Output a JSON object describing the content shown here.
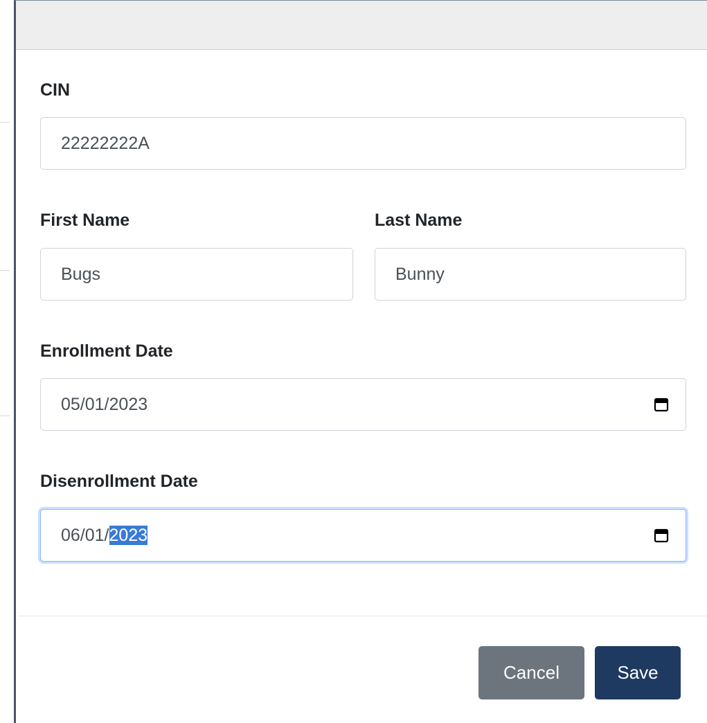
{
  "form": {
    "cin": {
      "label": "CIN",
      "value": "22222222A"
    },
    "first_name": {
      "label": "First Name",
      "value": "Bugs"
    },
    "last_name": {
      "label": "Last Name",
      "value": "Bunny"
    },
    "enrollment_date": {
      "label": "Enrollment Date",
      "value": "05/01/2023"
    },
    "disenrollment_date": {
      "label": "Disenrollment Date",
      "value_prefix": "06/01/",
      "value_selected": "2023"
    }
  },
  "footer": {
    "cancel_label": "Cancel",
    "save_label": "Save"
  },
  "colors": {
    "header_bg": "#eeeeee",
    "cancel_bg": "#6c757d",
    "save_bg": "#1f3a60",
    "focus_border": "#86b7fe",
    "selection_bg": "#3a7bd5"
  },
  "icons": {
    "date_picker": "calendar-icon"
  }
}
